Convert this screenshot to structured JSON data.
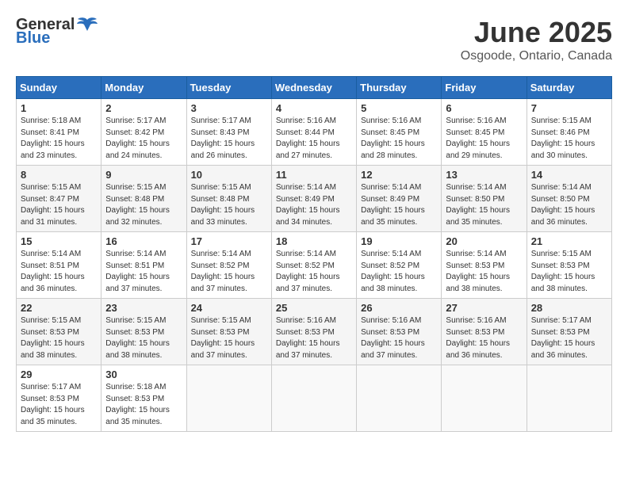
{
  "logo": {
    "general": "General",
    "blue": "Blue"
  },
  "title": "June 2025",
  "location": "Osgoode, Ontario, Canada",
  "days_header": [
    "Sunday",
    "Monday",
    "Tuesday",
    "Wednesday",
    "Thursday",
    "Friday",
    "Saturday"
  ],
  "weeks": [
    [
      {
        "day": "1",
        "info": "Sunrise: 5:18 AM\nSunset: 8:41 PM\nDaylight: 15 hours\nand 23 minutes."
      },
      {
        "day": "2",
        "info": "Sunrise: 5:17 AM\nSunset: 8:42 PM\nDaylight: 15 hours\nand 24 minutes."
      },
      {
        "day": "3",
        "info": "Sunrise: 5:17 AM\nSunset: 8:43 PM\nDaylight: 15 hours\nand 26 minutes."
      },
      {
        "day": "4",
        "info": "Sunrise: 5:16 AM\nSunset: 8:44 PM\nDaylight: 15 hours\nand 27 minutes."
      },
      {
        "day": "5",
        "info": "Sunrise: 5:16 AM\nSunset: 8:45 PM\nDaylight: 15 hours\nand 28 minutes."
      },
      {
        "day": "6",
        "info": "Sunrise: 5:16 AM\nSunset: 8:45 PM\nDaylight: 15 hours\nand 29 minutes."
      },
      {
        "day": "7",
        "info": "Sunrise: 5:15 AM\nSunset: 8:46 PM\nDaylight: 15 hours\nand 30 minutes."
      }
    ],
    [
      {
        "day": "8",
        "info": "Sunrise: 5:15 AM\nSunset: 8:47 PM\nDaylight: 15 hours\nand 31 minutes."
      },
      {
        "day": "9",
        "info": "Sunrise: 5:15 AM\nSunset: 8:48 PM\nDaylight: 15 hours\nand 32 minutes."
      },
      {
        "day": "10",
        "info": "Sunrise: 5:15 AM\nSunset: 8:48 PM\nDaylight: 15 hours\nand 33 minutes."
      },
      {
        "day": "11",
        "info": "Sunrise: 5:14 AM\nSunset: 8:49 PM\nDaylight: 15 hours\nand 34 minutes."
      },
      {
        "day": "12",
        "info": "Sunrise: 5:14 AM\nSunset: 8:49 PM\nDaylight: 15 hours\nand 35 minutes."
      },
      {
        "day": "13",
        "info": "Sunrise: 5:14 AM\nSunset: 8:50 PM\nDaylight: 15 hours\nand 35 minutes."
      },
      {
        "day": "14",
        "info": "Sunrise: 5:14 AM\nSunset: 8:50 PM\nDaylight: 15 hours\nand 36 minutes."
      }
    ],
    [
      {
        "day": "15",
        "info": "Sunrise: 5:14 AM\nSunset: 8:51 PM\nDaylight: 15 hours\nand 36 minutes."
      },
      {
        "day": "16",
        "info": "Sunrise: 5:14 AM\nSunset: 8:51 PM\nDaylight: 15 hours\nand 37 minutes."
      },
      {
        "day": "17",
        "info": "Sunrise: 5:14 AM\nSunset: 8:52 PM\nDaylight: 15 hours\nand 37 minutes."
      },
      {
        "day": "18",
        "info": "Sunrise: 5:14 AM\nSunset: 8:52 PM\nDaylight: 15 hours\nand 37 minutes."
      },
      {
        "day": "19",
        "info": "Sunrise: 5:14 AM\nSunset: 8:52 PM\nDaylight: 15 hours\nand 38 minutes."
      },
      {
        "day": "20",
        "info": "Sunrise: 5:14 AM\nSunset: 8:53 PM\nDaylight: 15 hours\nand 38 minutes."
      },
      {
        "day": "21",
        "info": "Sunrise: 5:15 AM\nSunset: 8:53 PM\nDaylight: 15 hours\nand 38 minutes."
      }
    ],
    [
      {
        "day": "22",
        "info": "Sunrise: 5:15 AM\nSunset: 8:53 PM\nDaylight: 15 hours\nand 38 minutes."
      },
      {
        "day": "23",
        "info": "Sunrise: 5:15 AM\nSunset: 8:53 PM\nDaylight: 15 hours\nand 38 minutes."
      },
      {
        "day": "24",
        "info": "Sunrise: 5:15 AM\nSunset: 8:53 PM\nDaylight: 15 hours\nand 37 minutes."
      },
      {
        "day": "25",
        "info": "Sunrise: 5:16 AM\nSunset: 8:53 PM\nDaylight: 15 hours\nand 37 minutes."
      },
      {
        "day": "26",
        "info": "Sunrise: 5:16 AM\nSunset: 8:53 PM\nDaylight: 15 hours\nand 37 minutes."
      },
      {
        "day": "27",
        "info": "Sunrise: 5:16 AM\nSunset: 8:53 PM\nDaylight: 15 hours\nand 36 minutes."
      },
      {
        "day": "28",
        "info": "Sunrise: 5:17 AM\nSunset: 8:53 PM\nDaylight: 15 hours\nand 36 minutes."
      }
    ],
    [
      {
        "day": "29",
        "info": "Sunrise: 5:17 AM\nSunset: 8:53 PM\nDaylight: 15 hours\nand 35 minutes."
      },
      {
        "day": "30",
        "info": "Sunrise: 5:18 AM\nSunset: 8:53 PM\nDaylight: 15 hours\nand 35 minutes."
      },
      {
        "day": "",
        "info": ""
      },
      {
        "day": "",
        "info": ""
      },
      {
        "day": "",
        "info": ""
      },
      {
        "day": "",
        "info": ""
      },
      {
        "day": "",
        "info": ""
      }
    ]
  ]
}
